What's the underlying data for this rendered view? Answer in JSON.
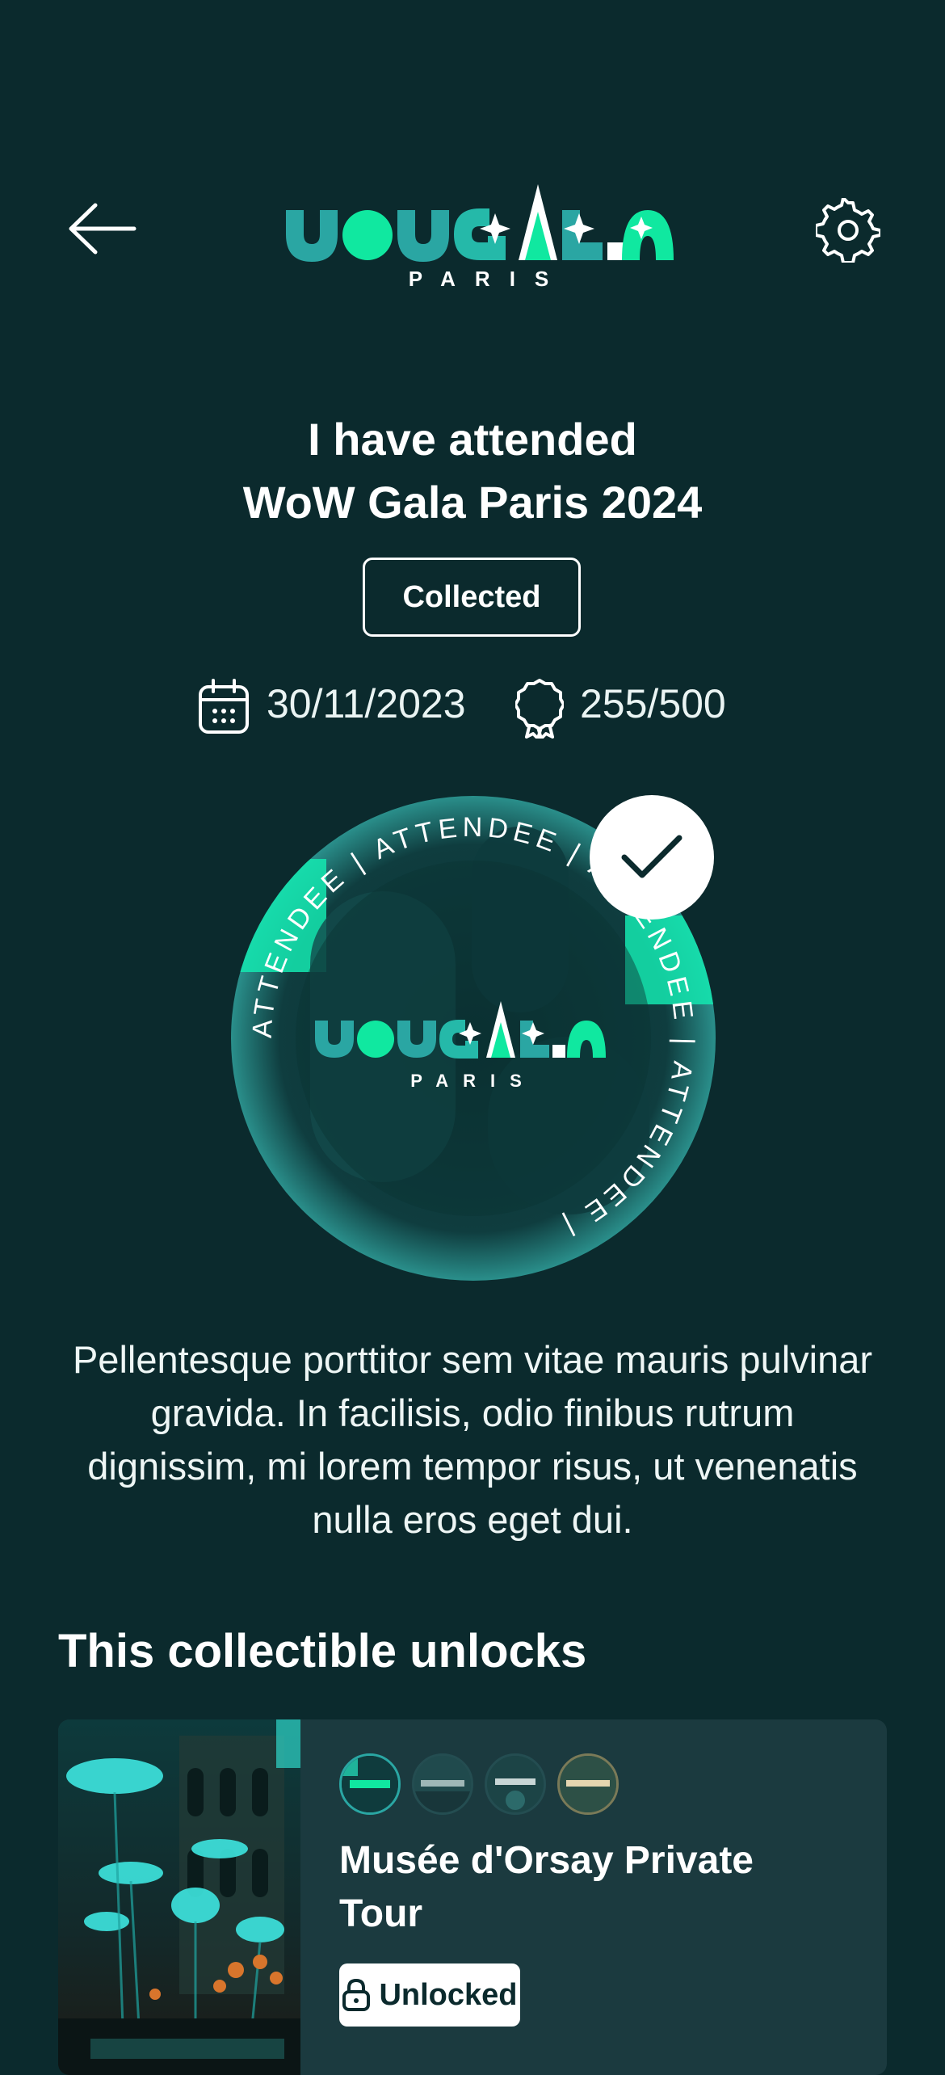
{
  "header": {
    "logo_text": "WOWGALA",
    "logo_subtext": "PARIS",
    "back_icon": "arrow-left-icon",
    "settings_icon": "gear-icon"
  },
  "collectible": {
    "title_line1": "I have attended",
    "title_line2": "WoW Gala Paris 2024",
    "status": "Collected",
    "date": "30/11/2023",
    "count": "255/500",
    "medal_ring_text": "ATTENDEE | ATTENDEE | ATTENDEE | ATTENDEE | ",
    "medal_logo": "WOWGALA",
    "medal_logo_sub": "PARIS",
    "description": "Pellentesque porttitor sem vitae mauris pulvinar gravida. In facilisis, odio finibus rutrum dignissim, mi lorem tempor risus, ut venenatis nulla eros eget dui."
  },
  "unlocks": {
    "section_title": "This collectible unlocks",
    "items": [
      {
        "title": "Musée d'Orsay Private Tour",
        "status": "Unlocked",
        "status_icon": "lock-icon"
      }
    ]
  },
  "colors": {
    "background": "#0b2a2d",
    "card": "#1b3a3f",
    "accent_green": "#10e8a0",
    "accent_teal": "#2aa6a3"
  }
}
